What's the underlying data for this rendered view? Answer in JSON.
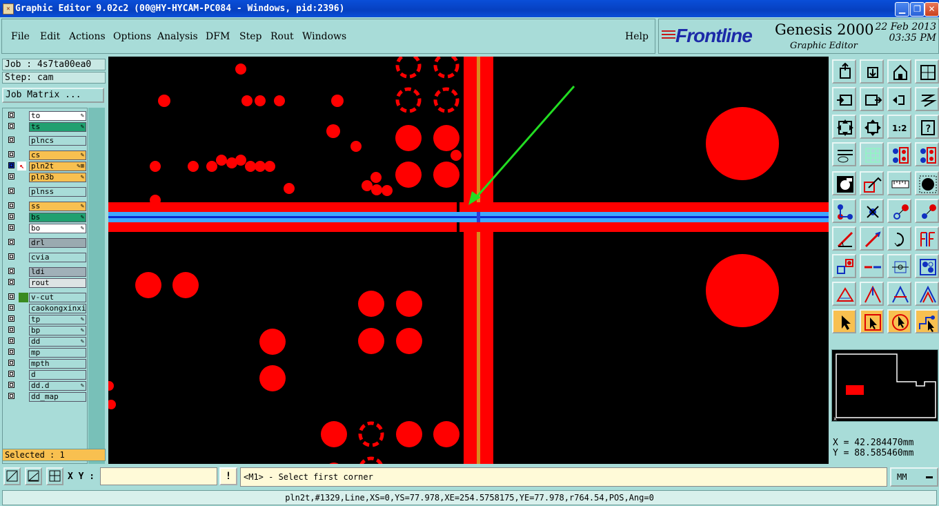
{
  "window": {
    "title": "Graphic Editor 9.02c2 (00@HY-HYCAM-PC084 - Windows, pid:2396)",
    "app_icon": "graphic-editor-icon",
    "controls": [
      "minimize-icon",
      "restore-icon",
      "close-icon"
    ]
  },
  "menu": {
    "items": [
      "File",
      "Edit",
      "Actions",
      "Options",
      "Analysis",
      "DFM",
      "Step",
      "Rout",
      "Windows"
    ],
    "help": "Help"
  },
  "logo": {
    "brand": "Frontline",
    "product": "Genesis 2000",
    "subtitle": "Graphic Editor",
    "date": "22 Feb 2013",
    "time": "03:35 PM"
  },
  "left": {
    "job": "Job : 4s7ta00ea0",
    "step": "Step: cam",
    "job_matrix": "Job Matrix ...",
    "selected": "Selected : 1",
    "layers": [
      {
        "name": "to",
        "color": "#ffffff",
        "mark": "✎",
        "work": false
      },
      {
        "name": "ts",
        "color": "#20a070",
        "mark": "✎",
        "work": false
      },
      {
        "name": "plncs",
        "color": "#a8dcd8",
        "mark": "",
        "work": false
      },
      {
        "name": "cs",
        "color": "#f8c050",
        "mark": "✎",
        "work": false
      },
      {
        "name": "pln2t",
        "color": "#f8c050",
        "mark": "✎⊞",
        "work": true
      },
      {
        "name": "pln3b",
        "color": "#f8c050",
        "mark": "✎",
        "work": false
      },
      {
        "name": "plnss",
        "color": "#a8dcd8",
        "mark": "",
        "work": false
      },
      {
        "name": "ss",
        "color": "#f8c050",
        "mark": "✎",
        "work": false
      },
      {
        "name": "bs",
        "color": "#20a070",
        "mark": "✎",
        "work": false
      },
      {
        "name": "bo",
        "color": "#ffffff",
        "mark": "✎",
        "work": false
      },
      {
        "name": "drl",
        "color": "#9aaab0",
        "mark": "",
        "work": false
      },
      {
        "name": "cvia",
        "color": "#a8dcd8",
        "mark": "",
        "work": false
      },
      {
        "name": "ldi",
        "color": "#a0b0b8",
        "mark": "",
        "work": false
      },
      {
        "name": "rout",
        "color": "#dde4e4",
        "mark": "",
        "work": false
      },
      {
        "name": "v-cut",
        "color": "#a8dcd8",
        "mark": "",
        "work": false,
        "swatch": "#3a8a20"
      },
      {
        "name": "caokongxinxi",
        "color": "#a8dcd8",
        "mark": "",
        "work": false
      },
      {
        "name": "tp",
        "color": "#a8dcd8",
        "mark": "✎",
        "work": false
      },
      {
        "name": "bp",
        "color": "#a8dcd8",
        "mark": "✎",
        "work": false
      },
      {
        "name": "dd",
        "color": "#a8dcd8",
        "mark": "✎",
        "work": false
      },
      {
        "name": "mp",
        "color": "#a8dcd8",
        "mark": "",
        "work": false
      },
      {
        "name": "mpth",
        "color": "#a8dcd8",
        "mark": "",
        "work": false
      },
      {
        "name": "d",
        "color": "#a8dcd8",
        "mark": "",
        "work": false
      },
      {
        "name": "dd.d",
        "color": "#a8dcd8",
        "mark": "✎",
        "work": false
      },
      {
        "name": "dd_map",
        "color": "#a8dcd8",
        "mark": "",
        "work": false
      }
    ]
  },
  "canvas": {
    "colors": {
      "feature": "#ff0000",
      "highlight": "#3fa8ff",
      "rout_line": "#d88a20",
      "arrow": "#22dd22",
      "background": "#000000"
    }
  },
  "toolbar": {
    "buttons": [
      "zoom-home-icon",
      "zoom-down-icon",
      "home-icon",
      "page-xy-icon",
      "zoom-left-icon",
      "zoom-right-icon",
      "undo-redo-icon",
      "snap-icon",
      "fit-window-icon",
      "fit-profile-icon",
      "scale-1-2-icon",
      "help-query-icon",
      "settings-palette-icon",
      "grid-icon",
      "net-colors-icon",
      "net-colors-alt-icon",
      "snapshot-icon",
      "outline-icon",
      "ruler-icon",
      "pad-icon",
      "net-connect-icon",
      "cross-icon",
      "add-pad-icon",
      "move-pad-icon",
      "line-angle-icon",
      "draw-line-icon",
      "arc-icon",
      "step-repeat-icon",
      "move-group-icon",
      "cut-line-icon",
      "center-icon",
      "matrix-pads-icon",
      "polygon-icon",
      "triangle-up-icon",
      "triangle-a-icon",
      "triangle-b-icon",
      "select-arrow-icon",
      "select-box-icon",
      "select-circle-icon",
      "select-net-icon"
    ]
  },
  "coords": {
    "x": "X = 42.284470mm",
    "y": "Y = 88.585460mm"
  },
  "bottom": {
    "xy_label": "X Y :",
    "xy_value": "",
    "prompt": "<M1> - Select first corner",
    "units": "MM",
    "status": "pln2t,#1329,Line,XS=0,YS=77.978,XE=254.5758175,YE=77.978,r764.54,POS,Ang=0"
  }
}
